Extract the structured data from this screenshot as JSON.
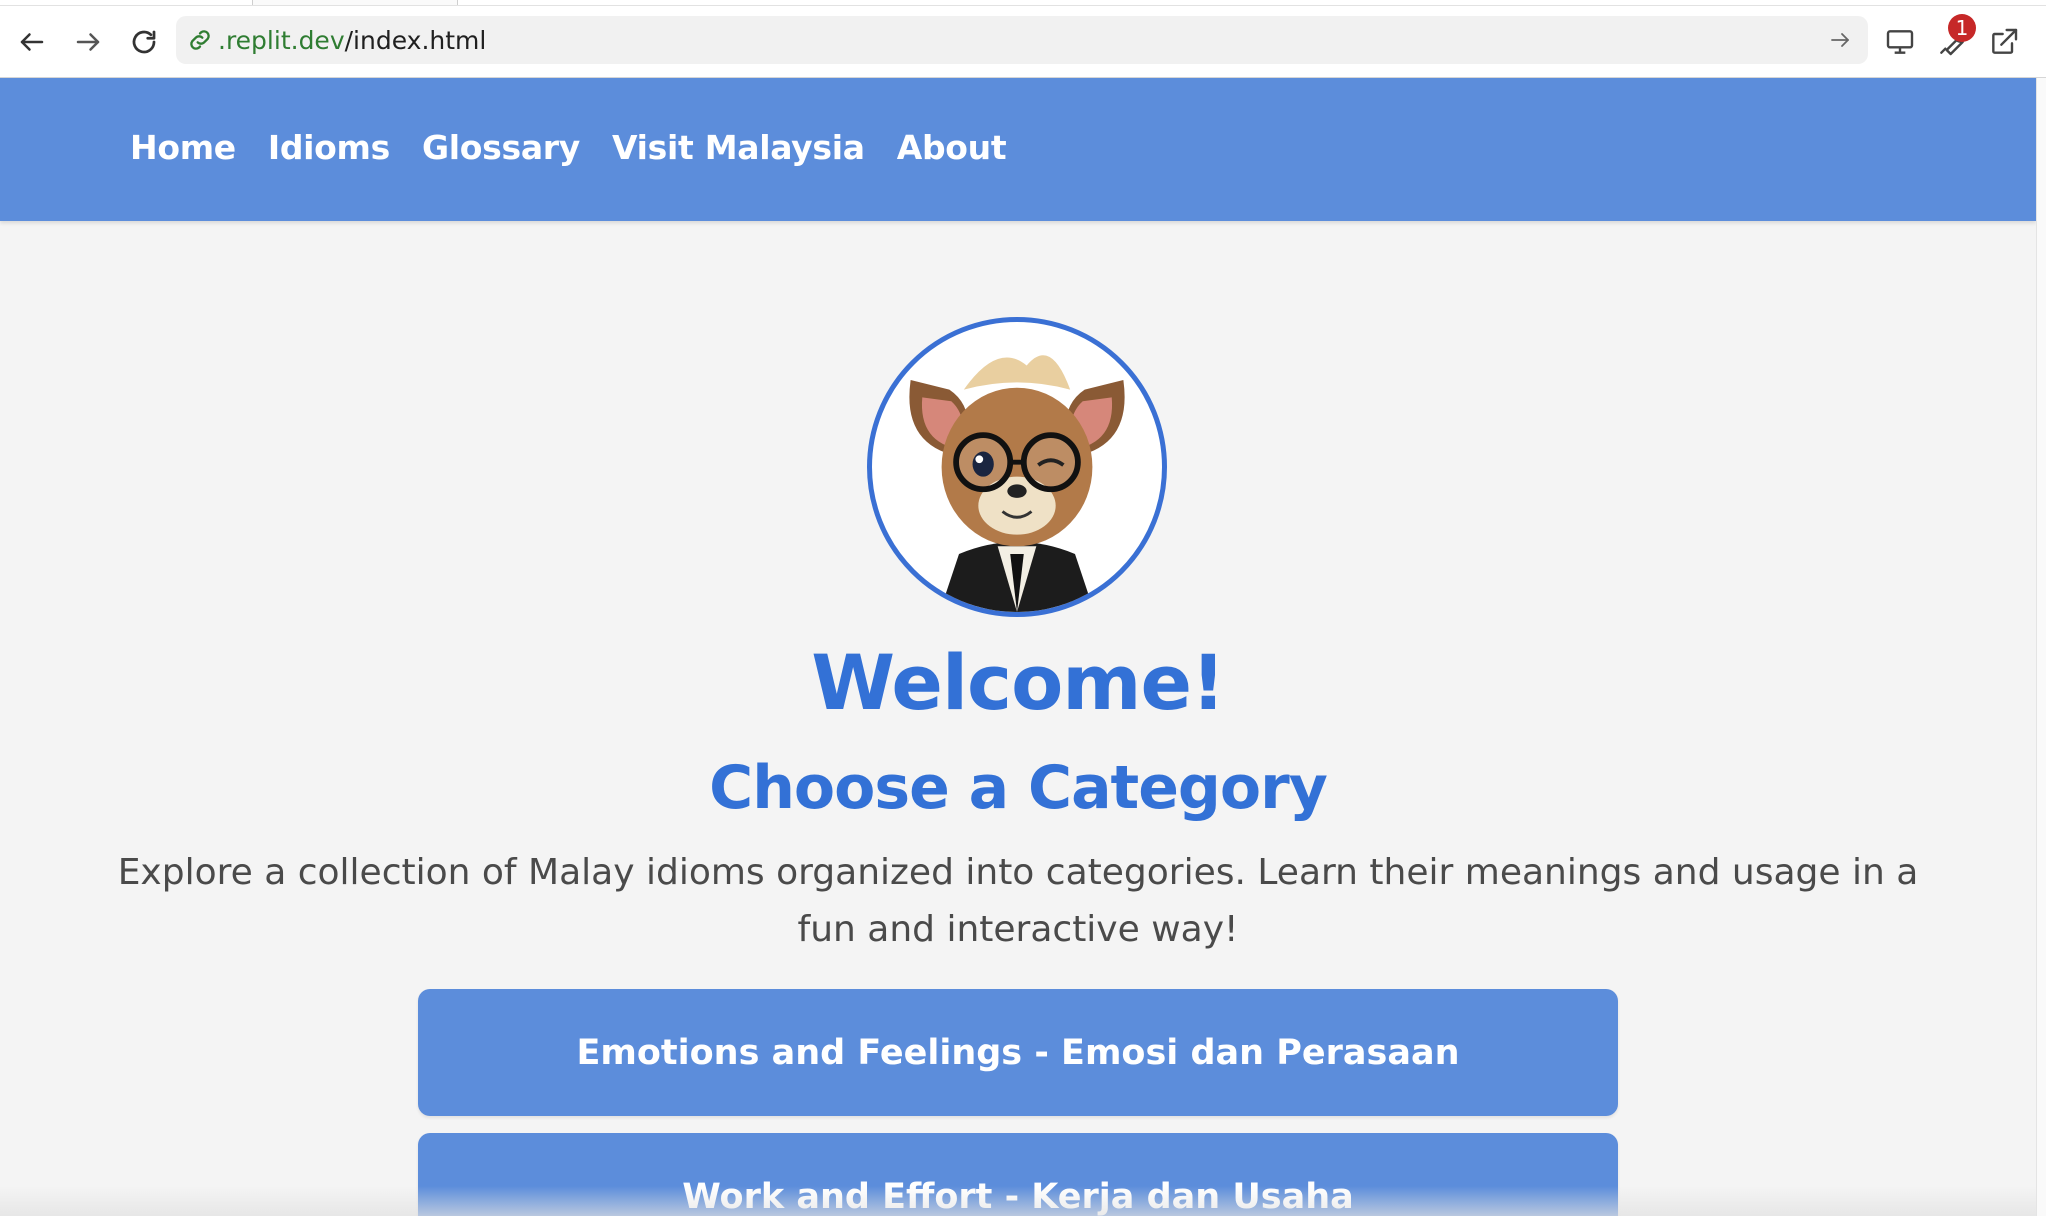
{
  "browser": {
    "url_domain": ".replit.dev",
    "url_path": "/index.html",
    "extension_badge": "1"
  },
  "nav": {
    "items": [
      {
        "label": "Home"
      },
      {
        "label": "Idioms"
      },
      {
        "label": "Glossary"
      },
      {
        "label": "Visit Malaysia"
      },
      {
        "label": "About"
      }
    ]
  },
  "hero": {
    "welcome": "Welcome!",
    "heading": "Choose a Category",
    "description": "Explore a collection of Malay idioms organized into categories. Learn their meanings and usage in a fun and interactive way!"
  },
  "categories": [
    {
      "label": "Emotions and Feelings - Emosi dan Perasaan"
    },
    {
      "label": "Work and Effort - Kerja dan Usaha"
    }
  ],
  "colors": {
    "nav_bg": "#5c8ddb",
    "heading": "#3371d6",
    "page_bg": "#f4f4f4",
    "badge": "#c62828"
  }
}
